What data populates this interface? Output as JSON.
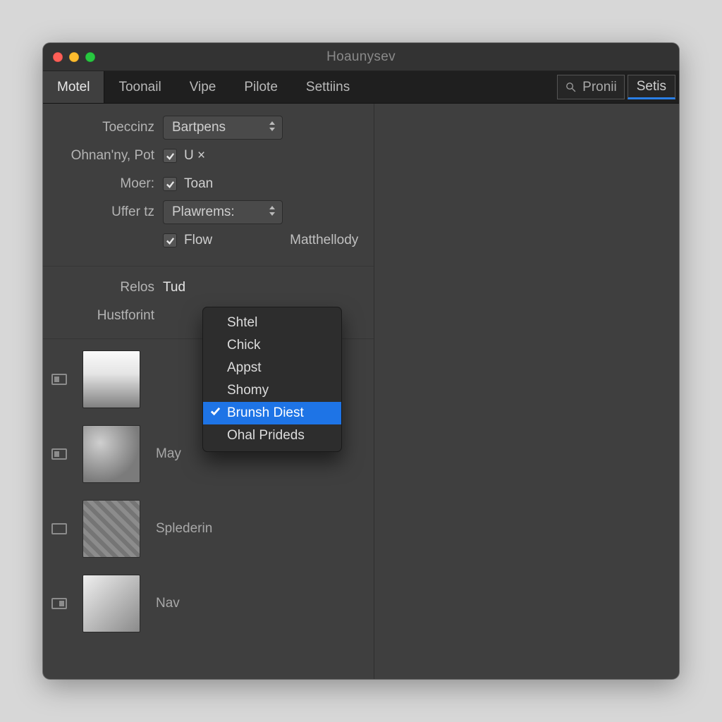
{
  "window": {
    "title": "Hoaunysev"
  },
  "tabs": [
    "Motel",
    "Toonail",
    "Vipe",
    "Pilote",
    "Settiins"
  ],
  "active_tab": 0,
  "toolbar": {
    "search_label": "Pronii",
    "setis_label": "Setis"
  },
  "form": {
    "label_toeccinz": "Toeccinz",
    "select_toeccinz": "Bartpens",
    "label_ohnanpot": "Ohnan'ny, Pot",
    "check_ux": "U ×",
    "label_moer": "Moer:",
    "check_toan": "Toan",
    "label_uffer": "Uffer tz",
    "select_uffer": "Plawrems:",
    "check_flow": "Flow",
    "math_label": "Matthellody"
  },
  "section2": {
    "label_relos": "Relos",
    "value_relos": "Tud",
    "label_hustforint": "Hustforint"
  },
  "list": [
    {
      "caption": ""
    },
    {
      "caption": "May"
    },
    {
      "caption": "Splederin"
    },
    {
      "caption": "Nav"
    }
  ],
  "popup": {
    "items": [
      "Shtel",
      "Chick",
      "Appst",
      "Shomy",
      "Brunsh Diest",
      "Ohal Prideds"
    ],
    "selected_index": 4
  }
}
